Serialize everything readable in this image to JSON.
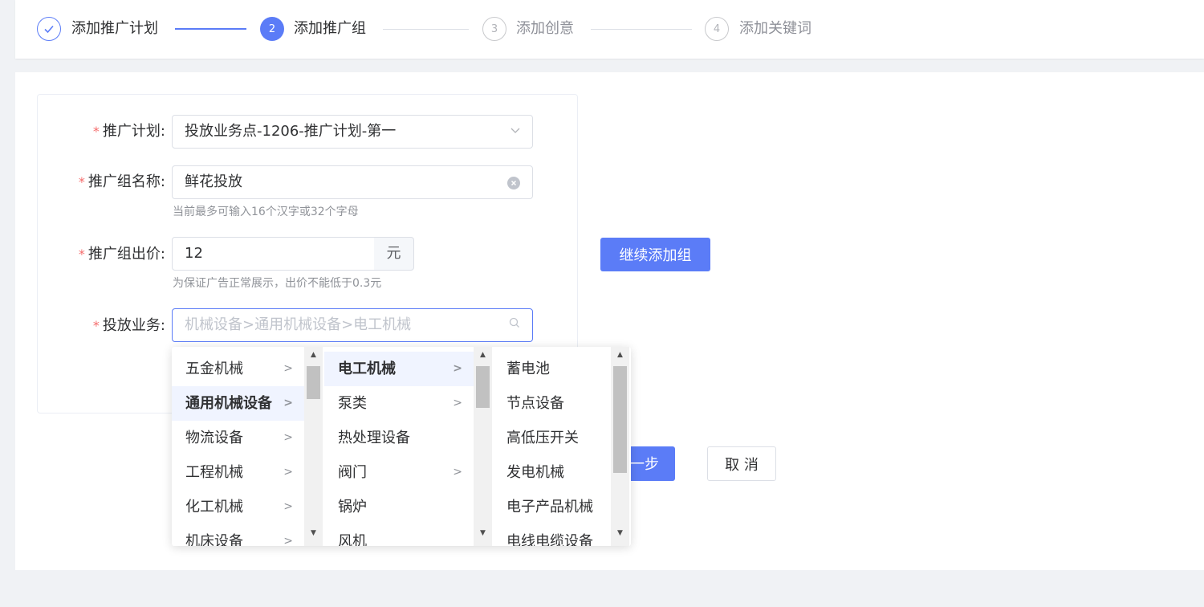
{
  "steps": [
    {
      "num": "",
      "title": "添加推广计划",
      "state": "done"
    },
    {
      "num": "2",
      "title": "添加推广组",
      "state": "active"
    },
    {
      "num": "3",
      "title": "添加创意",
      "state": "todo"
    },
    {
      "num": "4",
      "title": "添加关键词",
      "state": "todo"
    }
  ],
  "form": {
    "plan_label": "推广计划:",
    "plan_value": "投放业务点-1206-推广计划-第一",
    "group_name_label": "推广组名称:",
    "group_name_value": "鲜花投放",
    "group_name_hint": "当前最多可输入16个汉字或32个字母",
    "bid_label": "推广组出价:",
    "bid_value": "12",
    "bid_unit": "元",
    "bid_hint": "为保证广告正常展示，出价不能低于0.3元",
    "business_label": "投放业务:",
    "business_placeholder": "机械设备>通用机械设备>电工机械",
    "required_mark": "*"
  },
  "buttons": {
    "continue_add": "继续添加组",
    "next_step_partial": "一步",
    "cancel": "取 消"
  },
  "cascader": {
    "col1": [
      {
        "label": "五金机械",
        "has_children": true,
        "selected": false
      },
      {
        "label": "通用机械设备",
        "has_children": true,
        "selected": true
      },
      {
        "label": "物流设备",
        "has_children": true,
        "selected": false
      },
      {
        "label": "工程机械",
        "has_children": true,
        "selected": false
      },
      {
        "label": "化工机械",
        "has_children": true,
        "selected": false
      },
      {
        "label": "机床设备",
        "has_children": true,
        "selected": false
      }
    ],
    "col2": [
      {
        "label": "电工机械",
        "has_children": true,
        "selected": true
      },
      {
        "label": "泵类",
        "has_children": true,
        "selected": false
      },
      {
        "label": "热处理设备",
        "has_children": false,
        "selected": false
      },
      {
        "label": "阀门",
        "has_children": true,
        "selected": false
      },
      {
        "label": "锅炉",
        "has_children": false,
        "selected": false
      },
      {
        "label": "风机",
        "has_children": false,
        "selected": false
      }
    ],
    "col3": [
      {
        "label": "蓄电池",
        "has_children": false,
        "selected": false
      },
      {
        "label": "节点设备",
        "has_children": false,
        "selected": false
      },
      {
        "label": "高低压开关",
        "has_children": false,
        "selected": false
      },
      {
        "label": "发电机械",
        "has_children": false,
        "selected": false
      },
      {
        "label": "电子产品机械",
        "has_children": false,
        "selected": false
      },
      {
        "label": "电线电缆设备",
        "has_children": false,
        "selected": false
      }
    ]
  },
  "colors": {
    "primary": "#5b7cf7",
    "required": "#f56c6c"
  }
}
